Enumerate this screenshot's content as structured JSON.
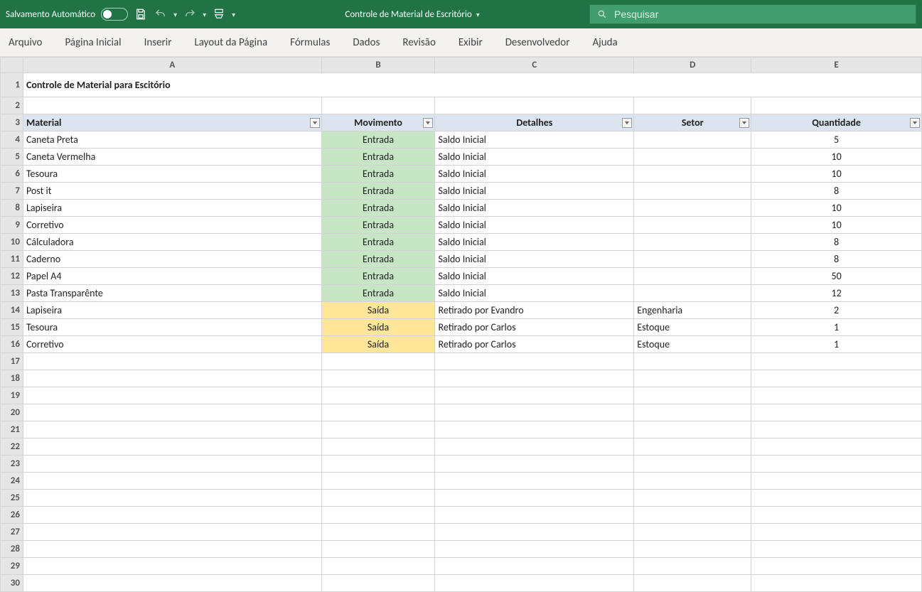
{
  "titlebar": {
    "autosave_label": "Salvamento Automático",
    "doc_title": "Controle de Material de Escritório"
  },
  "search": {
    "placeholder": "Pesquisar"
  },
  "ribbon": {
    "tabs": [
      "Arquivo",
      "Página Inicial",
      "Inserir",
      "Layout da Página",
      "Fórmulas",
      "Dados",
      "Revisão",
      "Exibir",
      "Desenvolvedor",
      "Ajuda"
    ]
  },
  "columns": {
    "letters": [
      "A",
      "B",
      "C",
      "D",
      "E"
    ]
  },
  "sheet": {
    "title": "Controle de Material para Escitório",
    "headers": {
      "material": "Material",
      "movimento": "Movimento",
      "detalhes": "Detalhes",
      "setor": "Setor",
      "quantidade": "Quantidade"
    },
    "rows": [
      {
        "material": "Caneta Preta",
        "movimento": "Entrada",
        "detalhes": "Saldo Inicial",
        "setor": "",
        "quantidade": "5"
      },
      {
        "material": "Caneta Vermelha",
        "movimento": "Entrada",
        "detalhes": "Saldo Inicial",
        "setor": "",
        "quantidade": "10"
      },
      {
        "material": "Tesoura",
        "movimento": "Entrada",
        "detalhes": "Saldo Inicial",
        "setor": "",
        "quantidade": "10"
      },
      {
        "material": "Post it",
        "movimento": "Entrada",
        "detalhes": "Saldo Inicial",
        "setor": "",
        "quantidade": "8"
      },
      {
        "material": "Lapiseira",
        "movimento": "Entrada",
        "detalhes": "Saldo Inicial",
        "setor": "",
        "quantidade": "10"
      },
      {
        "material": "Corretivo",
        "movimento": "Entrada",
        "detalhes": "Saldo Inicial",
        "setor": "",
        "quantidade": "10"
      },
      {
        "material": "Cálculadora",
        "movimento": "Entrada",
        "detalhes": "Saldo Inicial",
        "setor": "",
        "quantidade": "8"
      },
      {
        "material": "Caderno",
        "movimento": "Entrada",
        "detalhes": "Saldo Inicial",
        "setor": "",
        "quantidade": "8"
      },
      {
        "material": "Papel A4",
        "movimento": "Entrada",
        "detalhes": "Saldo Inicial",
        "setor": "",
        "quantidade": "50"
      },
      {
        "material": "Pasta Transparênte",
        "movimento": "Entrada",
        "detalhes": "Saldo Inicial",
        "setor": "",
        "quantidade": "12"
      },
      {
        "material": "Lapiseira",
        "movimento": "Saída",
        "detalhes": "Retirado por Evandro",
        "setor": "Engenharia",
        "quantidade": "2"
      },
      {
        "material": "Tesoura",
        "movimento": "Saída",
        "detalhes": "Retirado por Carlos",
        "setor": "Estoque",
        "quantidade": "1"
      },
      {
        "material": "Corretivo",
        "movimento": "Saída",
        "detalhes": "Retirado por Carlos",
        "setor": "Estoque",
        "quantidade": "1"
      }
    ]
  },
  "empty_rows": 14,
  "colors": {
    "entrada_bg": "#c6e6c6",
    "saida_bg": "#ffe699",
    "header_bg": "#dce4f0",
    "titlebar": "#217346"
  }
}
